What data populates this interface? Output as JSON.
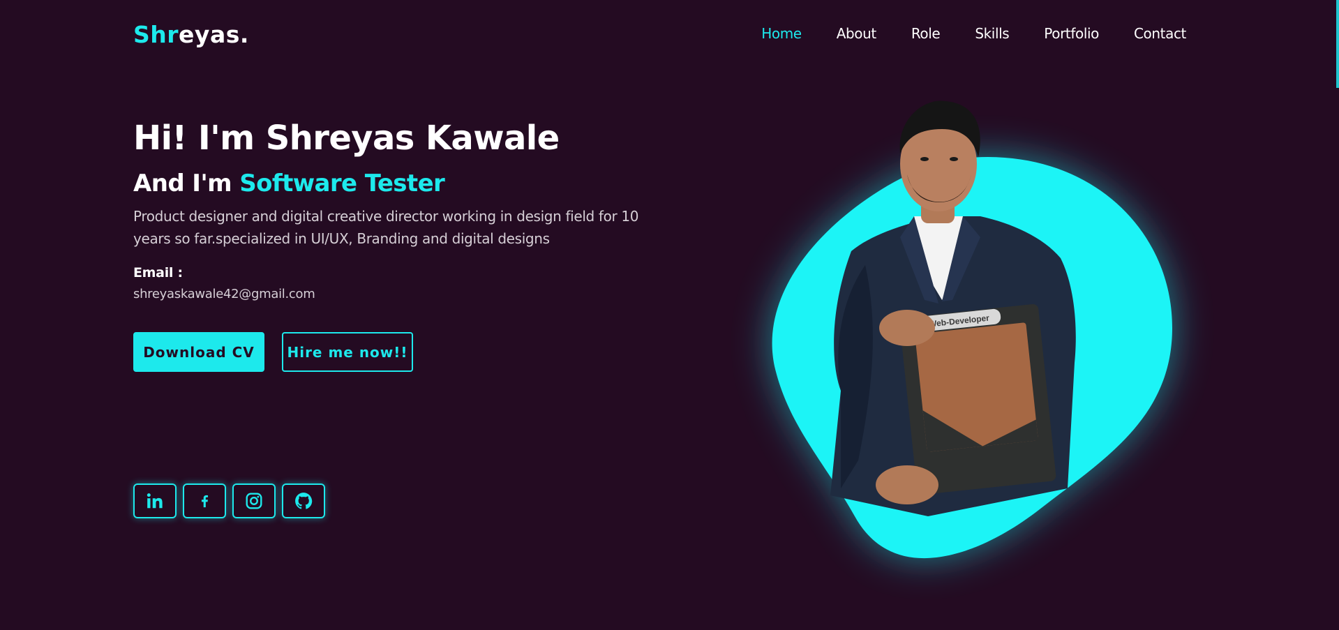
{
  "header": {
    "logo_accent": "Shr",
    "logo_rest": "eyas."
  },
  "nav": {
    "items": [
      {
        "label": "Home",
        "active": true
      },
      {
        "label": "About",
        "active": false
      },
      {
        "label": "Role",
        "active": false
      },
      {
        "label": "Skills",
        "active": false
      },
      {
        "label": "Portfolio",
        "active": false
      },
      {
        "label": "Contact",
        "active": false
      }
    ]
  },
  "hero": {
    "title": "Hi! I'm Shreyas Kawale",
    "subtitle_prefix": "And I'm",
    "role": "Software Tester",
    "description": "Product designer and digital creative director working in design field for 10 years so far.specialized in UI/UX, Branding and digital designs",
    "email_label": "Email :",
    "email_value": "shreyaskawale42@gmail.com"
  },
  "buttons": {
    "download_cv": "Download CV",
    "hire_me": "Hire me now!!"
  },
  "socials": [
    {
      "icon": "linkedin-icon"
    },
    {
      "icon": "facebook-icon"
    },
    {
      "icon": "instagram-icon"
    },
    {
      "icon": "github-icon"
    }
  ],
  "image": {
    "folder_label": "Web-Developer"
  },
  "colors": {
    "background": "#240b22",
    "accent": "#1de9ec",
    "text": "#ffffff",
    "muted_text": "#d6cfd6"
  }
}
